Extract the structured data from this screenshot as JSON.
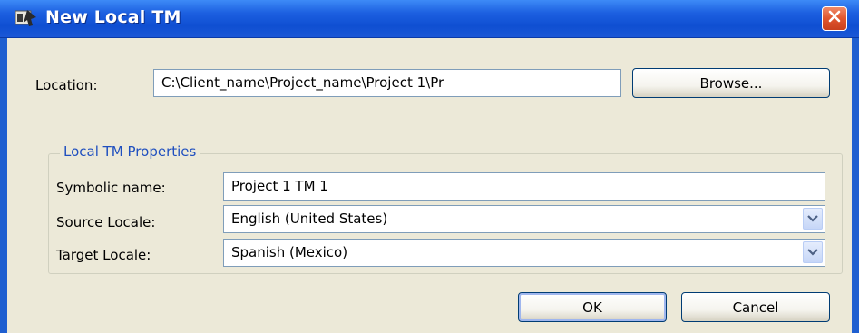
{
  "window": {
    "title": "New Local TM",
    "icon": "app-icon",
    "close_icon": "close-icon"
  },
  "location": {
    "label": "Location:",
    "value": "C:\\Client_name\\Project_name\\Project 1\\Pr",
    "browse_label": "Browse..."
  },
  "properties": {
    "group_label": "Local TM Properties",
    "symbolic_name_label": "Symbolic name:",
    "symbolic_name_value": "Project 1 TM 1",
    "source_locale_label": "Source Locale:",
    "source_locale_value": "English (United States)",
    "target_locale_label": "Target Locale:",
    "target_locale_value": "Spanish (Mexico)"
  },
  "buttons": {
    "ok_label": "OK",
    "cancel_label": "Cancel"
  },
  "colors": {
    "titlebar": "#1c5fe0",
    "dialog_bg": "#ece9d8",
    "group_label": "#1f4fbf",
    "close_button": "#e0552e"
  }
}
